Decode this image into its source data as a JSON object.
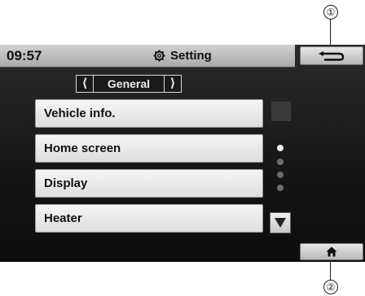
{
  "status_bar": {
    "time": "09:57",
    "title": "Setting",
    "title_icon": "gear-icon"
  },
  "category": {
    "label": "General",
    "prev_icon": "chevron-left-icon",
    "next_icon": "chevron-right-icon"
  },
  "menu": {
    "items": [
      {
        "label": "Vehicle info."
      },
      {
        "label": "Home screen"
      },
      {
        "label": "Display"
      },
      {
        "label": "Heater"
      }
    ]
  },
  "pagination": {
    "total": 4,
    "active_index": 0
  },
  "side_buttons": {
    "back_icon": "back-arrow-icon",
    "home_icon": "home-icon"
  },
  "callouts": {
    "one": "①",
    "two": "②"
  },
  "colors": {
    "screen_bg": "#151515",
    "status_bar_bg": "#bcbcbc",
    "menu_item_bg": "#ebebeb",
    "active_dot": "#f4f4f4",
    "inactive_dot": "#6d6d6d"
  }
}
